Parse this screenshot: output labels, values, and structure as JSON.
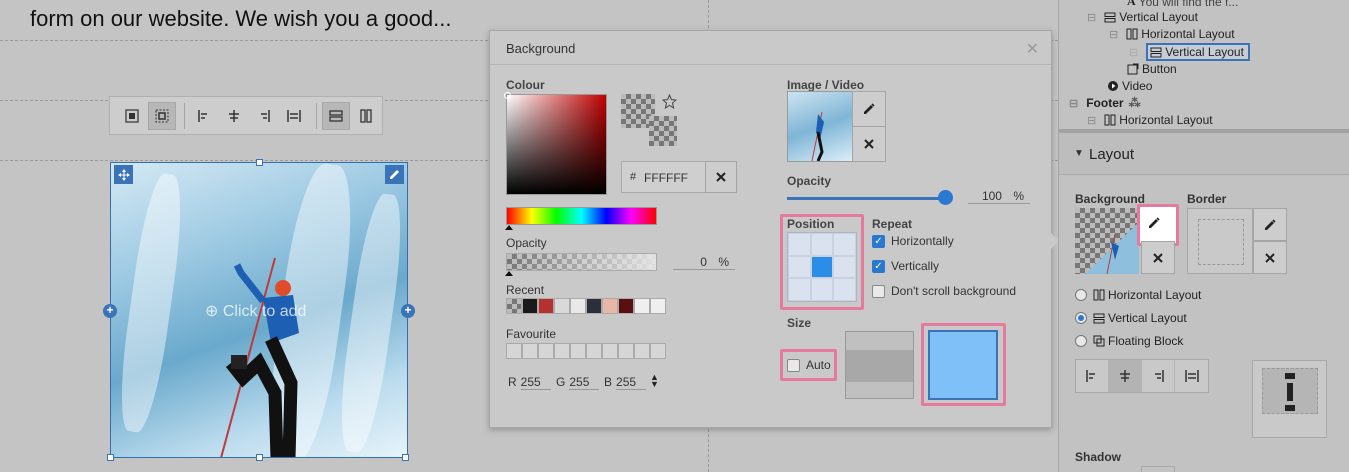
{
  "canvas": {
    "headline": "form on our website. We wish you a good...",
    "click_to_add": "Click to add"
  },
  "dialog": {
    "title": "Background",
    "close_icon": "close-icon",
    "colour_label": "Colour",
    "hex_prefix": "#",
    "hex_value": "FFFFFF",
    "opacity_label": "Opacity",
    "opacity_value": "0",
    "percent": "%",
    "recent_label": "Recent",
    "recent_colors": [
      "checker",
      "#1a1a1a",
      "#b5302e",
      "#d9d9d9",
      "#e9e9e9",
      "#2b2f3a",
      "#e7b8a8",
      "#5a1010",
      "#efefef",
      "#efefef"
    ],
    "favourite_label": "Favourite",
    "rgb": {
      "r_label": "R",
      "r": "255",
      "g_label": "G",
      "g": "255",
      "b_label": "B",
      "b": "255"
    },
    "image_video_label": "Image / Video",
    "media_opacity_label": "Opacity",
    "media_opacity_value": "100",
    "media_opacity_fraction": 1.0,
    "position_label": "Position",
    "repeat_label": "Repeat",
    "repeat_horizontally": "Horizontally",
    "repeat_vertically": "Vertically",
    "dont_scroll": "Don't scroll background",
    "size_label": "Size",
    "size_auto": "Auto"
  },
  "tree": {
    "item_partial": "You will find the f...",
    "item_vertical_layout_1": "Vertical Layout",
    "item_horizontal_layout_1": "Horizontal Layout",
    "item_vertical_layout_selected": "Vertical Layout",
    "item_button": "Button",
    "item_video": "Video",
    "item_footer": "Footer",
    "item_horizontal_layout_2": "Horizontal Layout"
  },
  "layout_panel": {
    "title": "Layout",
    "background_label": "Background",
    "border_label": "Border",
    "radio_horizontal": "Horizontal Layout",
    "radio_vertical": "Vertical Layout",
    "radio_floating": "Floating Block",
    "shadow_label": "Shadow"
  },
  "colors": {
    "accent": "#2b78d0",
    "highlight": "#e6799e",
    "selection_blue": "#3a73b8",
    "size_fill": "#80c0f8"
  }
}
